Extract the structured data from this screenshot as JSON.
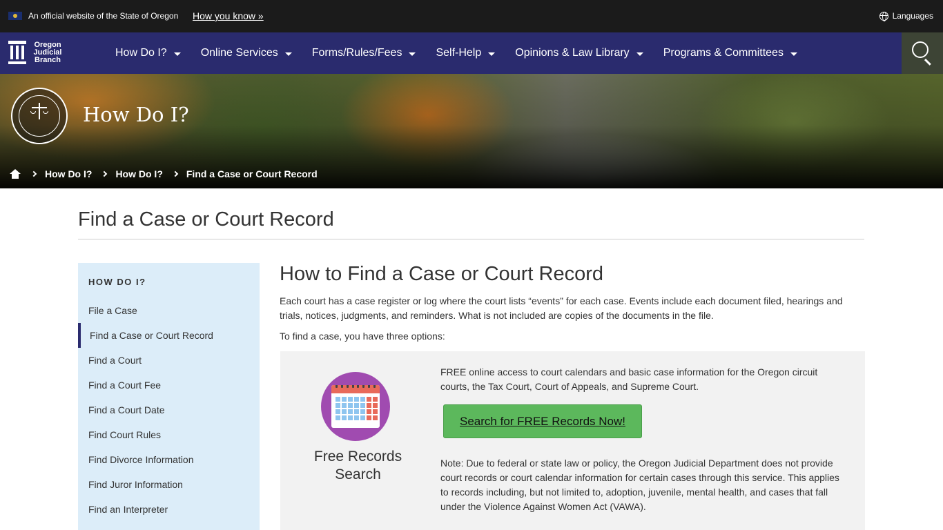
{
  "official": {
    "text": "An official website of the State of Oregon",
    "how_link": "How you know »",
    "languages": "Languages"
  },
  "logo": {
    "line1": "Oregon",
    "line2": "Judicial",
    "line3": "Branch"
  },
  "nav": {
    "items": [
      {
        "label": "How Do I?"
      },
      {
        "label": "Online Services"
      },
      {
        "label": "Forms/Rules/Fees"
      },
      {
        "label": "Self-Help"
      },
      {
        "label": "Opinions & Law Library"
      },
      {
        "label": "Programs & Committees"
      }
    ]
  },
  "hero": {
    "title": "How Do I?"
  },
  "breadcrumb": {
    "items": [
      "How Do I?",
      "How Do I?",
      "Find a Case or Court Record"
    ]
  },
  "page": {
    "title": "Find a Case or Court Record"
  },
  "sidebar": {
    "heading": "HOW DO I?",
    "items": [
      {
        "label": "File a Case"
      },
      {
        "label": "Find a Case or Court Record"
      },
      {
        "label": "Find a Court"
      },
      {
        "label": "Find a Court Fee"
      },
      {
        "label": "Find a Court Date"
      },
      {
        "label": "Find Court Rules"
      },
      {
        "label": "Find Divorce Information"
      },
      {
        "label": "Find Juror Information"
      },
      {
        "label": "Find an Interpreter"
      }
    ]
  },
  "main": {
    "heading": "How to Find a Case or Court Record",
    "intro": "Each court has a case register or log where the court lists “events” for each case. Events include each document filed, hearings and trials, notices, judgments, and reminders. What is not included are copies of the documents in the file.",
    "options_text": "To find a case, you have three options:"
  },
  "free_records": {
    "label": "Free Records Search",
    "description": "FREE online access to court calendars and basic case information for the Oregon circuit courts, the Tax Court, Court of Appeals, and Supreme Court.",
    "button": "Search for FREE Records Now!",
    "note": "Note: Due to federal or state law or policy, the Oregon Judicial Department does not provide court records or court calendar information for certain cases through this service. This applies to records including, but not limited to, adoption, juvenile, mental health, and cases that fall under the Violence Against Women Act (VAWA)."
  },
  "colors": {
    "nav_bg": "#2a2b6e",
    "official_bg": "#1b1b1b",
    "sidebar_bg": "#dcedf9",
    "button_green": "#5cb85c",
    "calendar_purple": "#a04bb0"
  }
}
